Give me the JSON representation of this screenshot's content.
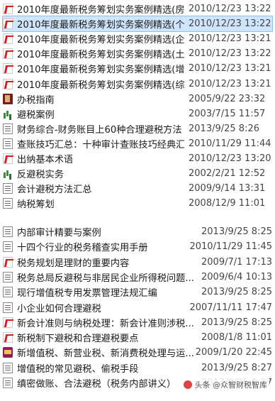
{
  "top_files": [
    {
      "name": "2010年度最新税务筹划实务案例精选(房...",
      "date": "2010/12/23 13:22",
      "icon": "pdf-icon"
    },
    {
      "name": "2010年度最新税务筹划实务案例精选(个...",
      "date": "2010/12/23 13:22",
      "icon": "pdf-icon",
      "selected": true
    },
    {
      "name": "2010年度最新税务筹划实务案例精选(企...",
      "date": "2010/12/23 13:21",
      "icon": "pdf-icon"
    },
    {
      "name": "2010年度最新税务筹划实务案例精选(土...",
      "date": "2010/12/23 13:22",
      "icon": "pdf-icon"
    },
    {
      "name": "2010年度最新税务筹划实务案例精选(增...",
      "date": "2010/12/23 13:21",
      "icon": "pdf-icon"
    },
    {
      "name": "2010年度最新税务筹划实务案例精选(综...",
      "date": "2010/12/23 13:21",
      "icon": "pdf-icon"
    },
    {
      "name": "办税指南",
      "date": "2005/9/22 23:32",
      "icon": "chm-icon"
    },
    {
      "name": "避税案例",
      "date": "2003/7/15 11:57",
      "icon": "chart-icon"
    },
    {
      "name": "财务综合-财务账目上60种合理避税方法",
      "date": "2013/9/25 8:26",
      "icon": "doc-icon"
    },
    {
      "name": "查账技巧汇总：十种审计查账技巧经典汇...",
      "date": "2010/11/29 11:44",
      "icon": "doc-icon"
    },
    {
      "name": "出纳基本术语",
      "date": "2010/12/23 13:20",
      "icon": "pdf-icon"
    },
    {
      "name": "反避税实务",
      "date": "2002/2/21 12:52",
      "icon": "chart-icon"
    },
    {
      "name": "会计避税方法汇总",
      "date": "2009/9/14 13:31",
      "icon": "doc-icon"
    },
    {
      "name": "纳税筹划",
      "date": "2008/12/9 11:01",
      "icon": "doc-icon"
    }
  ],
  "bottom_files": [
    {
      "name": "内部审计精要与案例",
      "date": "2013/9/25 8:25",
      "icon": "doc-icon"
    },
    {
      "name": "十四个行业的税务稽查实用手册",
      "date": "2010/11/29 11:45",
      "icon": "doc-icon"
    },
    {
      "name": "税务规划是理财的重要内容",
      "date": "2009/7/1 17:13",
      "icon": "pdf-icon"
    },
    {
      "name": "税务总局反避税与非居民企业所得税问题...",
      "date": "2009/6/4 10:13",
      "icon": "doc-icon"
    },
    {
      "name": "现行增值税专用发票管理法规汇编",
      "date": "2013/9/25 8:25",
      "icon": "doc-icon"
    },
    {
      "name": "小企业如何合理避税",
      "date": "2007/11/11 17:47",
      "icon": "doc-icon"
    },
    {
      "name": "新会计准则与纳税处理：新会计准则涉税...",
      "date": "2013/9/25 8:25",
      "icon": "pdf-icon"
    },
    {
      "name": "新税制下避税和合理避税要点",
      "date": "2008/1/8 11:01",
      "icon": "pdf-icon"
    },
    {
      "name": "新增值税、新营业税、新消费税处理与运...",
      "date": "2009/1/20 22:45",
      "icon": "rar-icon"
    },
    {
      "name": "增值税的常见避税、偷税手段",
      "date": "2013/9/25 8:27",
      "icon": "doc-icon"
    },
    {
      "name": "缜密做账、合法避税（税务内部讲义）",
      "date": "2013/9/25 8:27",
      "icon": "doc-icon"
    }
  ],
  "watermark": "头条 @众智财税智库"
}
